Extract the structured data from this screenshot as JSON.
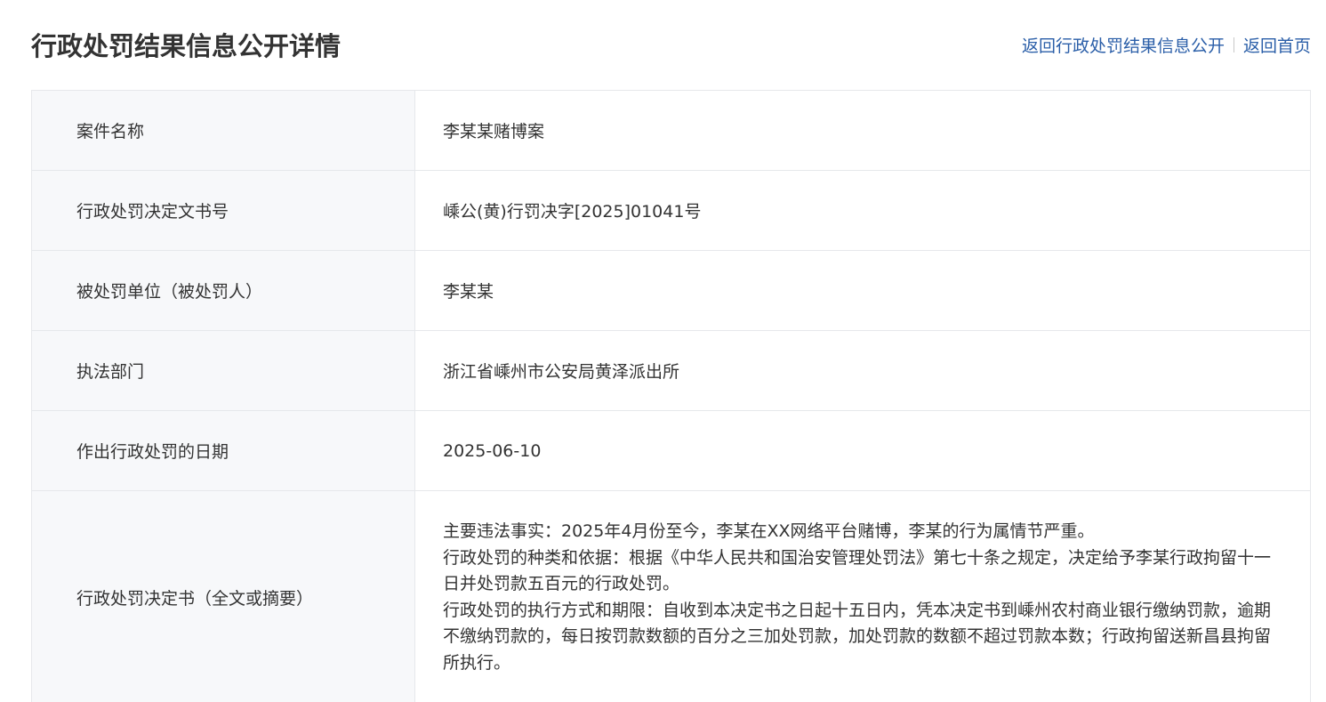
{
  "header": {
    "title": "行政处罚结果信息公开详情",
    "links": {
      "back_to_list": "返回行政处罚结果信息公开",
      "back_home": "返回首页"
    }
  },
  "details": {
    "rows": [
      {
        "label": "案件名称",
        "value": "李某某赌博案"
      },
      {
        "label": "行政处罚决定文书号",
        "value": "嵊公(黄)行罚决字[2025]01041号"
      },
      {
        "label": "被处罚单位（被处罚人）",
        "value": "李某某"
      },
      {
        "label": "执法部门",
        "value": "浙江省嵊州市公安局黄泽派出所"
      },
      {
        "label": "作出行政处罚的日期",
        "value": "2025-06-10"
      },
      {
        "label": "行政处罚决定书（全文或摘要）",
        "paragraphs": [
          "主要违法事实：2025年4月份至今，李某在XX网络平台赌博，李某的行为属情节严重。",
          "行政处罚的种类和依据：根据《中华人民共和国治安管理处罚法》第七十条之规定，决定给予李某行政拘留十一日并处罚款五百元的行政处罚。",
          "行政处罚的执行方式和期限：自收到本决定书之日起十五日内，凭本决定书到嵊州农村商业银行缴纳罚款，逾期不缴纳罚款的，每日按罚款数额的百分之三加处罚款，加处罚款的数额不超过罚款本数；行政拘留送新昌县拘留所执行。"
        ]
      }
    ]
  }
}
